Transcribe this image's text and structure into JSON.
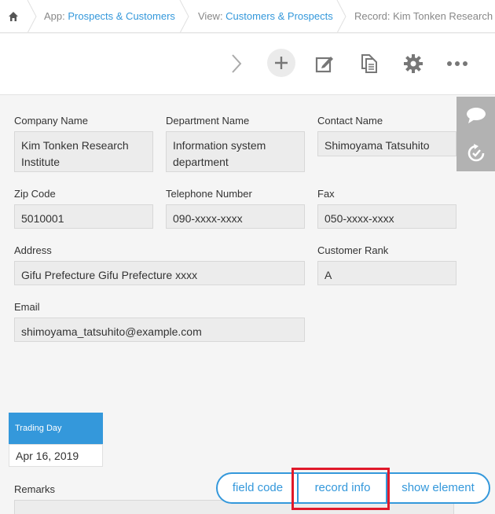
{
  "breadcrumb": {
    "app_prefix": "App: ",
    "app_name": "Prospects & Customers",
    "view_prefix": "View: ",
    "view_name": "Customers & Prospects",
    "record_label": "Record: Kim Tonken Research In"
  },
  "toolbar": {
    "icons": [
      "chevron-right-icon",
      "plus-icon",
      "edit-icon",
      "copy-icon",
      "gear-icon",
      "more-icon"
    ]
  },
  "form": {
    "company_name": {
      "label": "Company Name",
      "value": "Kim Tonken Research Institute"
    },
    "department_name": {
      "label": "Department Name",
      "value": "Information system department"
    },
    "contact_name": {
      "label": "Contact Name",
      "value": "Shimoyama Tatsuhito"
    },
    "zip_code": {
      "label": "Zip Code",
      "value": "5010001"
    },
    "telephone": {
      "label": "Telephone Number",
      "value": "090-xxxx-xxxx"
    },
    "fax": {
      "label": "Fax",
      "value": "050-xxxx-xxxx"
    },
    "address": {
      "label": "Address",
      "value": "Gifu Prefecture Gifu Prefecture xxxx"
    },
    "customer_rank": {
      "label": "Customer Rank",
      "value": "A"
    },
    "email": {
      "label": "Email",
      "value": "shimoyama_tatsuhito@example.com"
    },
    "trading_day": {
      "label": "Trading Day",
      "value": "Apr 16, 2019"
    },
    "remarks": {
      "label": "Remarks"
    }
  },
  "bottom_buttons": {
    "field_code": "field code",
    "record_info": "record info",
    "show_element": "show element"
  },
  "colors": {
    "accent": "#3498db",
    "highlight": "#e0192a",
    "side_panel": "#b2b2b2"
  }
}
